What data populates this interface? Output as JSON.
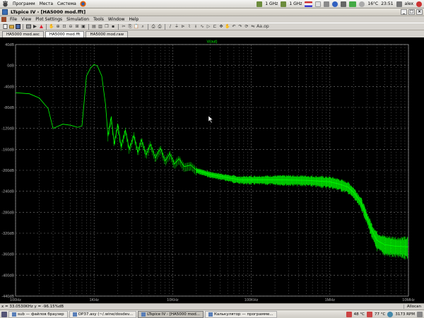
{
  "topbar": {
    "menus": [
      "Программ",
      "Места",
      "Система"
    ],
    "cpu1": "1 GHz",
    "cpu2": "1 GHz",
    "temperature": "16°C",
    "time": "23:51",
    "user": "alex"
  },
  "window": {
    "title": "LTspice IV - [HA5000 mod.fft]"
  },
  "menubar": [
    "File",
    "View",
    "Plot Settings",
    "Simulation",
    "Tools",
    "Window",
    "Help"
  ],
  "tabs": [
    {
      "label": "HA5000 mod.asc",
      "active": false
    },
    {
      "label": "HA5000 mod.fft",
      "active": true
    },
    {
      "label": "HA5000 mod.raw",
      "active": false
    }
  ],
  "chart_data": {
    "type": "line",
    "series": [
      {
        "name": "V(out)",
        "color": "#00ff00"
      }
    ],
    "y_ticks": [
      "40dB",
      "0dB",
      "-40dB",
      "-80dB",
      "-120dB",
      "-160dB",
      "-200dB",
      "-240dB",
      "-280dB",
      "-320dB",
      "-360dB",
      "-400dB",
      "-440dB"
    ],
    "x_ticks": [
      "100Hz",
      "1KHz",
      "10KHz",
      "100KHz",
      "1MHz",
      "10MHz"
    ],
    "ylim": [
      -440,
      40
    ],
    "xlim": [
      100,
      10000000
    ],
    "x_scale": "log",
    "grid": true,
    "envelope": [
      [
        100,
        -52
      ],
      [
        150,
        -54
      ],
      [
        200,
        -62
      ],
      [
        260,
        -82
      ],
      [
        300,
        -120
      ],
      [
        400,
        -112
      ],
      [
        500,
        -114
      ],
      [
        620,
        -118
      ],
      [
        700,
        -115
      ],
      [
        800,
        -20
      ],
      [
        900,
        -5
      ],
      [
        1000,
        2
      ],
      [
        1100,
        -1
      ],
      [
        1250,
        -20
      ],
      [
        1400,
        -75
      ],
      [
        1500,
        -135
      ],
      [
        1650,
        -98
      ],
      [
        1800,
        -150
      ],
      [
        2000,
        -112
      ],
      [
        2200,
        -155
      ],
      [
        2500,
        -123
      ],
      [
        2800,
        -160
      ],
      [
        3200,
        -133
      ],
      [
        3600,
        -165
      ],
      [
        4000,
        -142
      ],
      [
        4600,
        -170
      ],
      [
        5200,
        -150
      ],
      [
        6000,
        -176
      ],
      [
        7000,
        -158
      ],
      [
        8000,
        -182
      ],
      [
        9200,
        -168
      ],
      [
        10500,
        -188
      ],
      [
        12000,
        -178
      ],
      [
        14000,
        -193
      ],
      [
        17000,
        -190
      ],
      [
        20000,
        -200
      ],
      [
        30000,
        -208
      ],
      [
        50000,
        -214
      ],
      [
        70000,
        -218
      ],
      [
        100000,
        -218
      ],
      [
        200000,
        -218
      ],
      [
        500000,
        -219
      ],
      [
        1000000,
        -222
      ],
      [
        1300000,
        -226
      ],
      [
        1700000,
        -232
      ],
      [
        2000000,
        -242
      ],
      [
        2500000,
        -262
      ],
      [
        3000000,
        -292
      ],
      [
        3500000,
        -318
      ],
      [
        4000000,
        -334
      ],
      [
        5000000,
        -342
      ],
      [
        7000000,
        -345
      ],
      [
        10000000,
        -346
      ]
    ],
    "band": [
      [
        20000,
        12
      ],
      [
        50000,
        14
      ],
      [
        100000,
        18
      ],
      [
        400000,
        22
      ],
      [
        1000000,
        24
      ],
      [
        2000000,
        24
      ],
      [
        3000000,
        25
      ],
      [
        4000000,
        40
      ],
      [
        10000000,
        45
      ]
    ],
    "cursor_readout": "x = 33.0530KHz   y = -96.15%dB"
  },
  "statusbar": {
    "readout": "x = 33.0530KHz   y = -96.15%dB",
    "mode": "Allocan"
  },
  "taskbar": {
    "items": [
      {
        "label": "sub — файлов браузер",
        "active": false
      },
      {
        "label": "OP37.asy (~/.wine/dosdev...",
        "active": false
      },
      {
        "label": "LTspice IV - [HA5000 mod...",
        "active": true
      },
      {
        "label": "Калькулятор — программе...",
        "active": false
      }
    ],
    "temp1": "48 °C",
    "temp2": "77 °C",
    "fan": "3173 RPM"
  }
}
